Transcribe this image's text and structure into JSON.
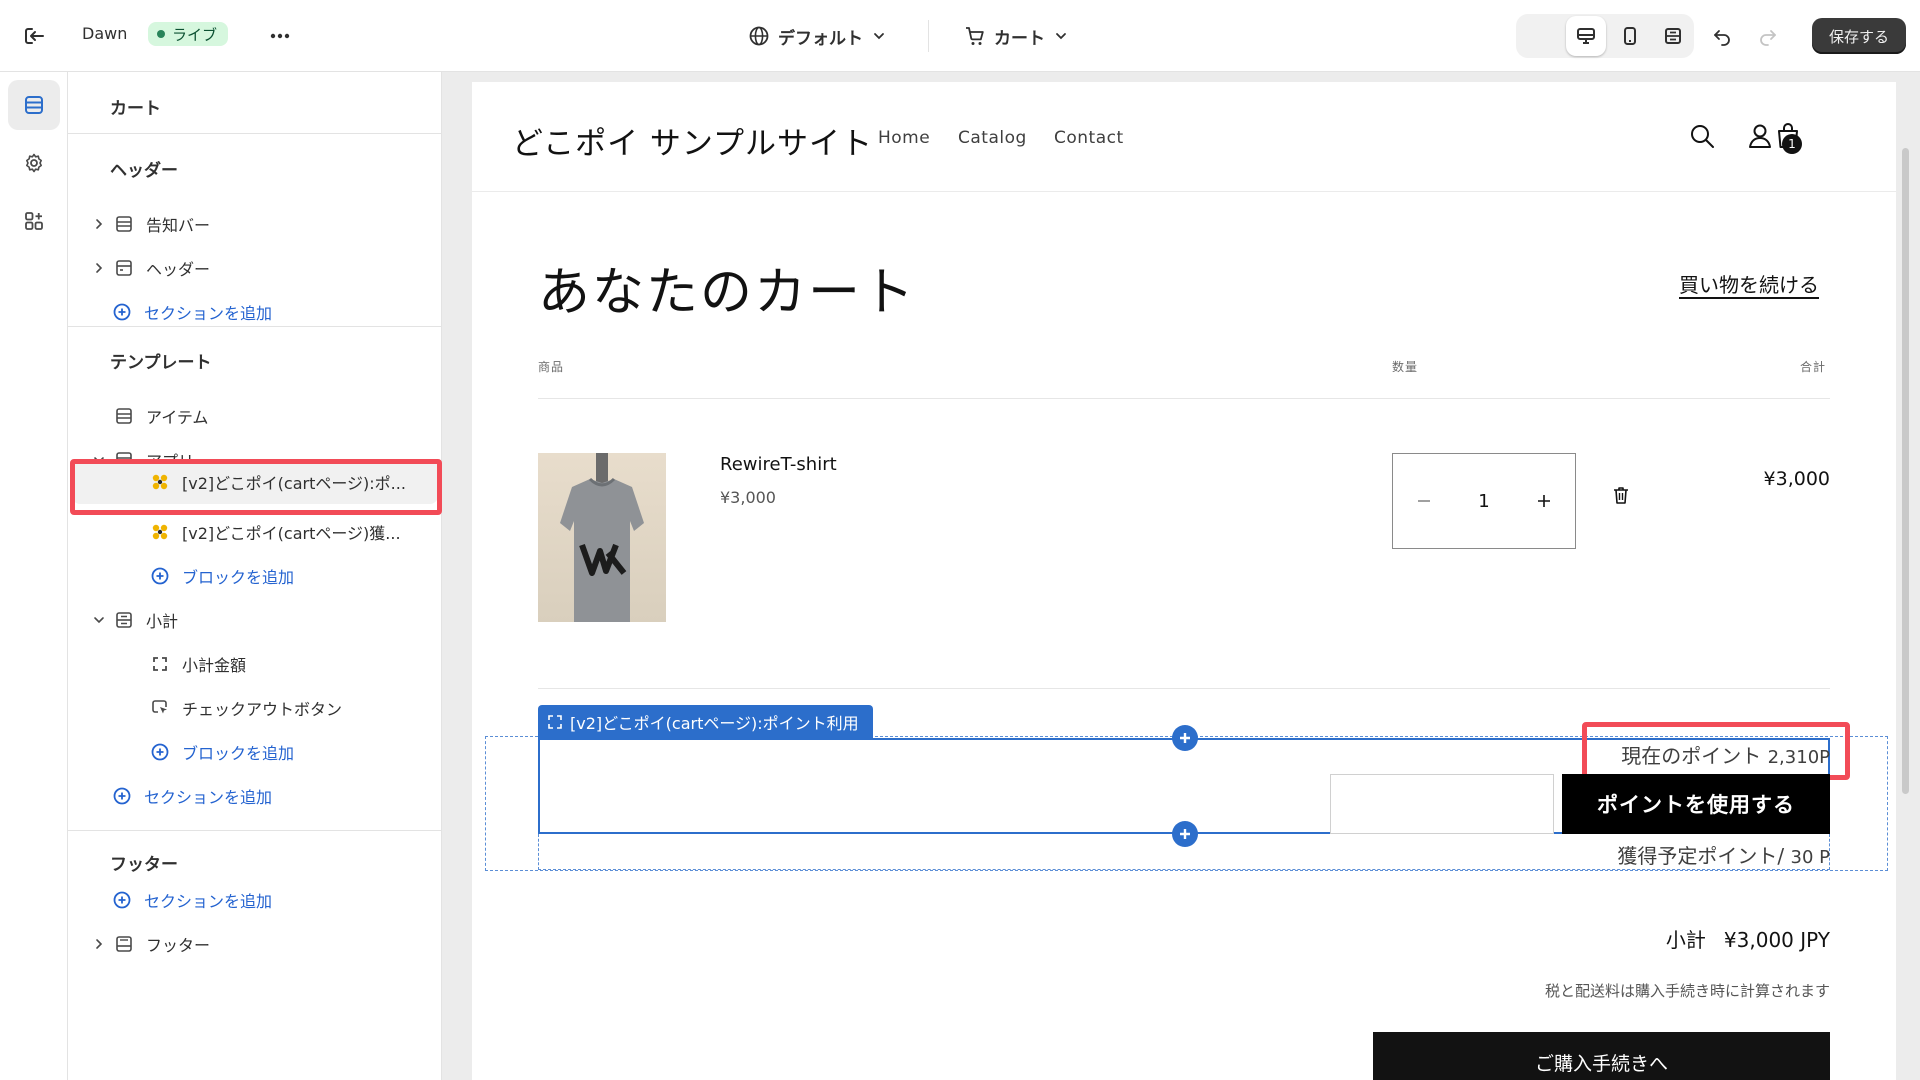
{
  "topbar": {
    "exit_icon": "exit-icon",
    "theme_name": "Dawn",
    "live_badge": "ライブ",
    "more_icon": "more-horizontal-icon",
    "language_selector": "デフォルト",
    "template_selector": "カート",
    "save_button": "保存する",
    "tools": [
      "inspector-icon",
      "desktop-view-icon",
      "mobile-view-icon",
      "fullscreen-icon",
      "undo-icon",
      "redo-icon"
    ],
    "colors": {
      "live_bg": "#d6f7de",
      "live_dot": "#29845a",
      "save_bg": "#3a3a3a"
    }
  },
  "rail": {
    "items": [
      "sections-icon",
      "theme-settings-icon",
      "apps-icon"
    ],
    "active": "sections-icon"
  },
  "sidebar": {
    "title": "カート",
    "header_group": {
      "title": "ヘッダー",
      "items": [
        "告知バー",
        "ヘッダー"
      ],
      "add": "セクションを追加"
    },
    "template_group": {
      "title": "テンプレート",
      "items": [
        "アイテム",
        "アプリ"
      ],
      "app_blocks": [
        "[v2]どこポイ(cartページ):ポ...",
        "[v2]どこポイ(cartページ)獲..."
      ],
      "add_block": "ブロックを追加",
      "subtotal": "小計",
      "subtotal_blocks": [
        "小計金額",
        "チェックアウトボタン"
      ],
      "add_block_2": "ブロックを追加",
      "add_section": "セクションを追加"
    },
    "footer_group": {
      "title": "フッター",
      "add": "セクションを追加",
      "items": [
        "フッター"
      ]
    },
    "highlight_color": "#f24b57",
    "accent_color": "#2463d0"
  },
  "store": {
    "logo": "どこポイ サンプルサイト",
    "nav": [
      "Home",
      "Catalog",
      "Contact"
    ],
    "cart_count": "1",
    "page_title": "あなたのカート",
    "continue_shopping": "買い物を続ける",
    "columns": {
      "product": "商品",
      "quantity": "数量",
      "total": "合計"
    },
    "item": {
      "name": "RewireT-shirt",
      "price": "¥3,000",
      "quantity": "1",
      "total": "¥3,000"
    },
    "app_block_label": "[v2]どこポイ(cartページ):ポイント利用",
    "points_current_label": "現在のポイント",
    "points_current_value": "2,310P",
    "points_use_button": "ポイントを使用する",
    "points_earn_label": "獲得予定ポイント/",
    "points_earn_value": "30 P",
    "subtotal_label": "小計",
    "subtotal_value": "¥3,000 JPY",
    "tax_note": "税と配送料は購入手続き時に計算されます",
    "checkout_button": "ご購入手続きへ",
    "editor_accent": "#2c6ecb"
  }
}
